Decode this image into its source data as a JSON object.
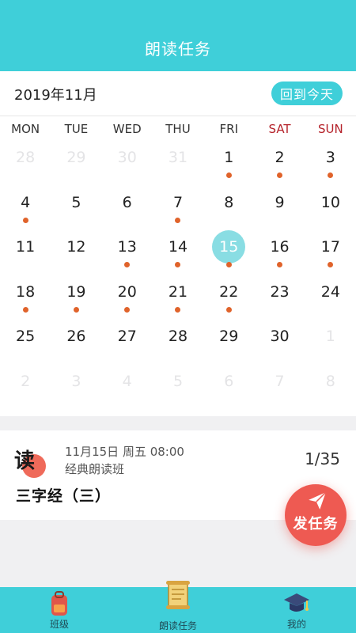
{
  "header": {
    "title": "朗读任务"
  },
  "calendar": {
    "month_label": "2019年11月",
    "today_button": "回到今天",
    "weekdays": [
      "MON",
      "TUE",
      "WED",
      "THU",
      "FRI",
      "SAT",
      "SUN"
    ],
    "weeks": [
      [
        {
          "d": "28",
          "muted": true
        },
        {
          "d": "29",
          "muted": true
        },
        {
          "d": "30",
          "muted": true
        },
        {
          "d": "31",
          "muted": true
        },
        {
          "d": "1",
          "dot": true
        },
        {
          "d": "2",
          "dot": true
        },
        {
          "d": "3",
          "dot": true
        }
      ],
      [
        {
          "d": "4",
          "dot": true
        },
        {
          "d": "5"
        },
        {
          "d": "6"
        },
        {
          "d": "7",
          "dot": true
        },
        {
          "d": "8"
        },
        {
          "d": "9"
        },
        {
          "d": "10"
        }
      ],
      [
        {
          "d": "11"
        },
        {
          "d": "12"
        },
        {
          "d": "13",
          "dot": true
        },
        {
          "d": "14",
          "dot": true
        },
        {
          "d": "15",
          "dot": true,
          "today": true
        },
        {
          "d": "16",
          "dot": true
        },
        {
          "d": "17",
          "dot": true
        }
      ],
      [
        {
          "d": "18",
          "dot": true
        },
        {
          "d": "19",
          "dot": true
        },
        {
          "d": "20",
          "dot": true
        },
        {
          "d": "21",
          "dot": true
        },
        {
          "d": "22",
          "dot": true
        },
        {
          "d": "23"
        },
        {
          "d": "24"
        }
      ],
      [
        {
          "d": "25"
        },
        {
          "d": "26"
        },
        {
          "d": "27"
        },
        {
          "d": "28"
        },
        {
          "d": "29"
        },
        {
          "d": "30"
        },
        {
          "d": "1",
          "muted": true
        }
      ],
      [
        {
          "d": "2",
          "muted": true
        },
        {
          "d": "3",
          "muted": true
        },
        {
          "d": "4",
          "muted": true
        },
        {
          "d": "5",
          "muted": true
        },
        {
          "d": "6",
          "muted": true
        },
        {
          "d": "7",
          "muted": true
        },
        {
          "d": "8",
          "muted": true
        }
      ]
    ]
  },
  "task": {
    "badge_char": "读",
    "meta": "11月15日 周五 08:00",
    "class_name": "经典朗读班",
    "count": "1/35",
    "lesson": "三字经（三）"
  },
  "fab": {
    "label": "发任务",
    "icon": "paper-plane-icon"
  },
  "tabbar": {
    "tabs": [
      {
        "label": "班级",
        "icon": "backpack-icon"
      },
      {
        "label": "朗读任务",
        "icon": "scroll-icon"
      },
      {
        "label": "我的",
        "icon": "graduation-cap-icon"
      }
    ]
  },
  "colors": {
    "accent": "#3fcfd9",
    "dot": "#e0632b",
    "weekend": "#b5232b",
    "today_circle": "#89dde3",
    "fab": "#ee5a52"
  }
}
